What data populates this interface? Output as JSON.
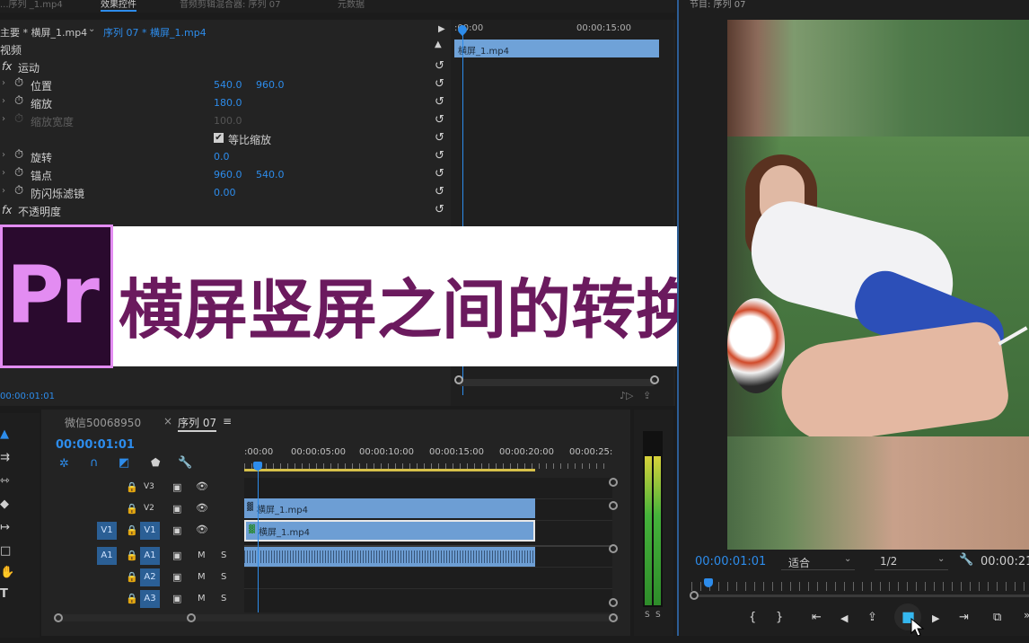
{
  "tabs_top": {
    "left_cut": "...序列 _1.mp4",
    "effect_controls": "效果控件",
    "audio_mixer": "音频剪辑混合器: 序列 07",
    "metadata": "元数据"
  },
  "program_title": "节目: 序列 07",
  "effect_controls": {
    "source_label": "主要 * 横屏_1.mp4",
    "sequence_label": "序列 07 * 横屏_1.mp4",
    "video_header": "视频",
    "motion": "运动",
    "position": {
      "label": "位置",
      "x": "540.0",
      "y": "960.0"
    },
    "scale": {
      "label": "缩放",
      "value": "180.0"
    },
    "scale_width": {
      "label": "缩放宽度",
      "value": "100.0"
    },
    "uniform_scale": "等比缩放",
    "rotation": {
      "label": "旋转",
      "value": "0.0"
    },
    "anchor": {
      "label": "锚点",
      "x": "960.0",
      "y": "540.0"
    },
    "antiflicker": {
      "label": "防闪烁滤镜",
      "value": "0.00"
    },
    "opacity": "不透明度",
    "timecode": "00:00:01:01",
    "mini_timeline": {
      "start": ":00:00",
      "mark": "00:00:15:00",
      "clip": "横屏_1.mp4"
    }
  },
  "banner": {
    "logo": "Pr",
    "title": "横屏竖屏之间的转换",
    "title_color": "#6b1a5e",
    "logo_bg": "#2a0a2e",
    "logo_fg": "#e38cf2"
  },
  "timeline": {
    "tab1": "微信50068950",
    "tab2": "序列 07",
    "timecode": "00:00:01:01",
    "ruler": [
      ":00:00",
      "00:00:05:00",
      "00:00:10:00",
      "00:00:15:00",
      "00:00:20:00",
      "00:00:25:"
    ],
    "tracks": [
      {
        "name": "V3"
      },
      {
        "name": "V2"
      },
      {
        "src": "V1",
        "name": "V1"
      },
      {
        "src": "A1",
        "name": "A1"
      },
      {
        "name": "A2"
      },
      {
        "name": "A3"
      }
    ],
    "clip_v2": "横屏_1.mp4",
    "clip_v1": "横屏_1.mp4",
    "m_label": "M",
    "s_label": "S"
  },
  "program": {
    "timecode": "00:00:01:01",
    "fit": "适合",
    "resolution": "1/2",
    "duration": "00:00:21"
  },
  "meter_labels": [
    "S",
    "S"
  ],
  "controls": [
    "{",
    "}",
    "⇤",
    "◀",
    "⇪",
    "■",
    "▶",
    "⇥",
    "⧉"
  ]
}
